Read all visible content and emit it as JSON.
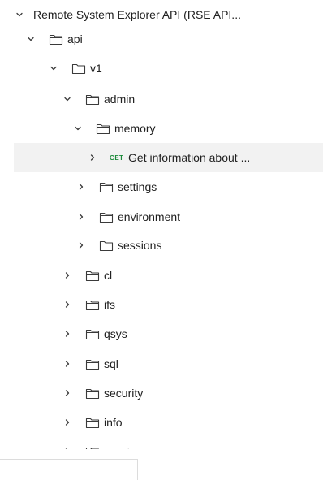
{
  "tree": {
    "root": {
      "label": "Remote System Explorer API (RSE API...",
      "expanded": true
    },
    "nodes": [
      {
        "id": "api",
        "label": "api",
        "type": "folder",
        "expanded": true
      },
      {
        "id": "v1",
        "label": "v1",
        "type": "folder",
        "expanded": true
      },
      {
        "id": "admin",
        "label": "admin",
        "type": "folder",
        "expanded": true
      },
      {
        "id": "memory",
        "label": "memory",
        "type": "folder",
        "expanded": true
      },
      {
        "id": "get-info",
        "label": "Get information about ...",
        "type": "request",
        "method": "GET",
        "expanded": false,
        "selected": true
      },
      {
        "id": "settings",
        "label": "settings",
        "type": "folder",
        "expanded": false
      },
      {
        "id": "environment",
        "label": "environment",
        "type": "folder",
        "expanded": false
      },
      {
        "id": "sessions",
        "label": "sessions",
        "type": "folder",
        "expanded": false
      },
      {
        "id": "cl",
        "label": "cl",
        "type": "folder",
        "expanded": false
      },
      {
        "id": "ifs",
        "label": "ifs",
        "type": "folder",
        "expanded": false
      },
      {
        "id": "qsys",
        "label": "qsys",
        "type": "folder",
        "expanded": false
      },
      {
        "id": "sql",
        "label": "sql",
        "type": "folder",
        "expanded": false
      },
      {
        "id": "security",
        "label": "security",
        "type": "folder",
        "expanded": false
      },
      {
        "id": "info",
        "label": "info",
        "type": "folder",
        "expanded": false
      },
      {
        "id": "session",
        "label": "session",
        "type": "folder",
        "expanded": false
      }
    ]
  },
  "colors": {
    "text": "#212121",
    "icon": "#3a3a3a",
    "get_method": "#1b8a3a",
    "selected_row": "#f2f2f2"
  },
  "icons": {
    "expanded": "chevron-down-icon",
    "collapsed": "chevron-right-icon",
    "folder": "folder-icon"
  }
}
